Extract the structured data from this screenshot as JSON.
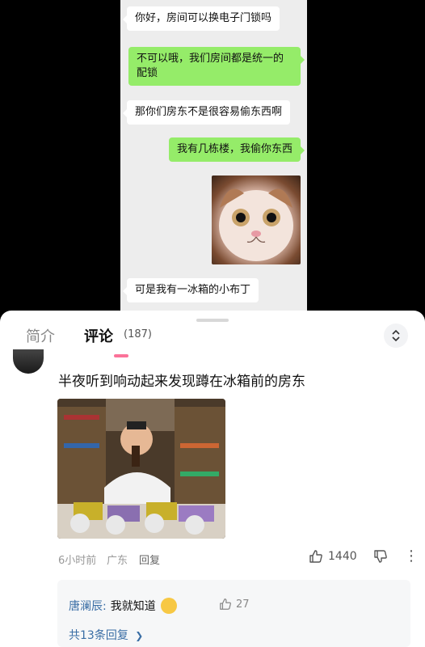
{
  "chat": {
    "messages": [
      {
        "side": "in",
        "text": "你好，房间可以换电子门锁吗"
      },
      {
        "side": "out",
        "line1": "不可以哦，我们房间都是统一的",
        "line2": "配锁"
      },
      {
        "side": "in",
        "text": "那你们房东不是很容易偷东西啊"
      },
      {
        "side": "out",
        "text": "我有几栋楼，我偷你东西"
      },
      {
        "side": "out",
        "image": "cat-face-image"
      },
      {
        "side": "in",
        "text": "可是我有一冰箱的小布丁"
      }
    ]
  },
  "tabs": {
    "intro": "简介",
    "comments": "评论",
    "count": "(187)"
  },
  "comment": {
    "text": "半夜听到响动起来发现蹲在冰箱前的房东",
    "time": "6小时前",
    "location": "广东",
    "reply": "回复",
    "likes": "1440"
  },
  "replies": {
    "user": "唐澜辰:",
    "text": "我就知道",
    "likes": "27",
    "see_more": "共13条回复",
    "see_more_arrow": "❯"
  },
  "colors": {
    "accent": "#fb7299",
    "wechat_green": "#95ec69",
    "link": "#3a6ea5"
  }
}
